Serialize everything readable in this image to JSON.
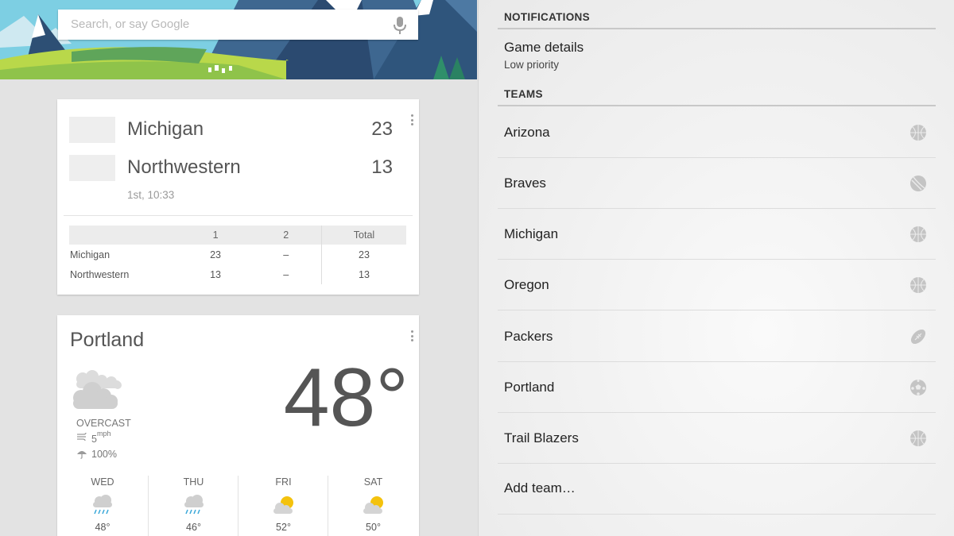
{
  "search": {
    "placeholder": "Search, or say Google",
    "icon": "mic-icon"
  },
  "score_card": {
    "teams": [
      {
        "name": "Michigan",
        "score": "23"
      },
      {
        "name": "Northwestern",
        "score": "13"
      }
    ],
    "status": "1st, 10:33",
    "linescore": {
      "headers": [
        "",
        "1",
        "2",
        "Total"
      ],
      "rows": [
        [
          "Michigan",
          "23",
          "–",
          "23"
        ],
        [
          "Northwestern",
          "13",
          "–",
          "13"
        ]
      ]
    }
  },
  "weather_card": {
    "city": "Portland",
    "temperature": "48°",
    "condition": "OVERCAST",
    "wind_value": "5",
    "wind_unit": "mph",
    "precip": "100%",
    "forecast": [
      {
        "day": "WED",
        "temp": "48°",
        "icon": "rain-icon"
      },
      {
        "day": "THU",
        "temp": "46°",
        "icon": "rain-icon"
      },
      {
        "day": "FRI",
        "temp": "52°",
        "icon": "partly-sunny-icon"
      },
      {
        "day": "SAT",
        "temp": "50°",
        "icon": "partly-sunny-icon"
      }
    ]
  },
  "settings": {
    "notifications_header": "NOTIFICATIONS",
    "game_details": {
      "title": "Game details",
      "subtitle": "Low priority"
    },
    "teams_header": "TEAMS",
    "teams": [
      {
        "name": "Arizona",
        "sport": "basketball"
      },
      {
        "name": "Braves",
        "sport": "baseball"
      },
      {
        "name": "Michigan",
        "sport": "basketball"
      },
      {
        "name": "Oregon",
        "sport": "basketball"
      },
      {
        "name": "Packers",
        "sport": "football"
      },
      {
        "name": "Portland",
        "sport": "soccer"
      },
      {
        "name": "Trail Blazers",
        "sport": "basketball"
      }
    ],
    "add_team": "Add team…"
  },
  "colors": {
    "accent": "#3aa8d8",
    "sun": "#f4c20d",
    "icon_gray": "#c4c4c4"
  }
}
